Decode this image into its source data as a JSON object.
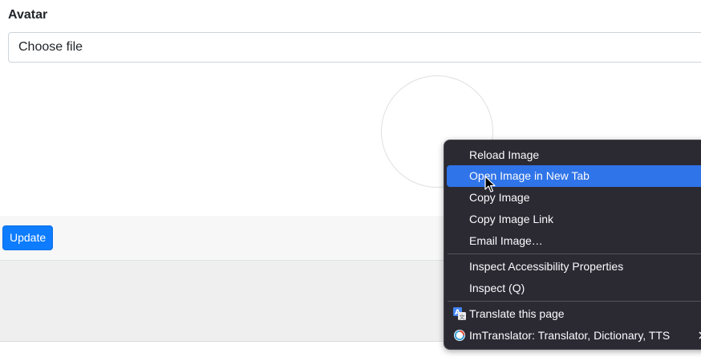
{
  "form": {
    "avatar_label": "Avatar",
    "file_input_value": "Choose file",
    "update_label": "Update"
  },
  "context_menu": {
    "items": [
      {
        "label": "Reload Image"
      },
      {
        "label": "Open Image in New Tab"
      },
      {
        "label": "Copy Image"
      },
      {
        "label": "Copy Image Link"
      },
      {
        "label": "Email Image…"
      },
      {
        "label": "Inspect Accessibility Properties"
      },
      {
        "label": "Inspect (Q)"
      },
      {
        "label": "Translate this page"
      },
      {
        "label": "ImTranslator: Translator, Dictionary, TTS"
      }
    ],
    "highlighted_index": 1,
    "colors": {
      "background": "#2b2a33",
      "highlight": "#2f74e8",
      "text": "#fbfbfe"
    }
  },
  "colors": {
    "primary_button": "#0d7cff"
  }
}
